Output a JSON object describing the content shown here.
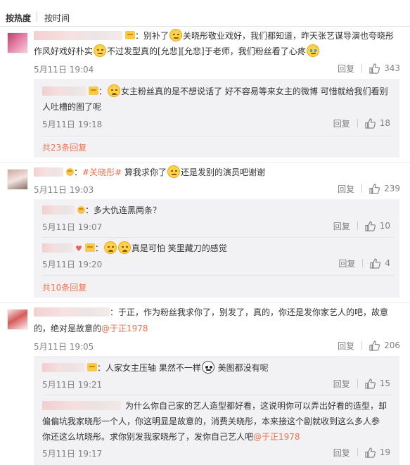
{
  "sort": {
    "hot": "按热度",
    "time": "按时间"
  },
  "icons": {
    "like": "thumbs-up-icon",
    "vip": "vip-badge-icon"
  },
  "colors": {
    "link": "#eb7350",
    "meta": "#808080",
    "subpanel": "#f2f2f5"
  },
  "comments": [
    {
      "text_parts": [
        "：别补了",
        "关晓彤敬业戏好，我们都知道，昨天张艺谋导演也夸晓彤",
        "作风好戏好朴实",
        "不过发型真的[允悲][允悲]于老师，我们粉丝看了心疼"
      ],
      "date": "5月11日 19:04",
      "reply": "回复",
      "likes": "343",
      "replies": [
        {
          "text_a": "：",
          "text_b": "女主粉丝真的是不想说话了 好不容易等来女主的微博 可惜就给我们看别",
          "text_c": "人吐槽的图了呢",
          "date": "5月11日 19:18",
          "reply": "回复",
          "likes": "18"
        }
      ],
      "more": "共23条回复"
    },
    {
      "text_a": "：",
      "topic": "#关晓彤#",
      "text_b": " 算我求你了",
      "text_c": "还是发别的演员吧谢谢",
      "date": "5月11日 19:03",
      "reply": "回复",
      "likes": "239",
      "replies": [
        {
          "text": "：多大仇连黑两条？",
          "date": "5月11日 19:07",
          "reply": "回复",
          "likes": "10"
        },
        {
          "text_a": "：",
          "text_b": "真是可怕 笑里藏刀的感觉",
          "date": "5月11日 19:20",
          "reply": "回复",
          "likes": "4"
        }
      ],
      "more": "共10条回复"
    },
    {
      "text_a": "：于正，作为粉丝我求你了，别发了，真的，你还是发你家艺人的吧，故意",
      "text_b": "的，绝对是故意的",
      "mention": "@于正1978",
      "date": "5月11日 19:05",
      "reply": "回复",
      "likes": "206",
      "replies": [
        {
          "text_a": "：人家女主压轴 果然不一样",
          "text_b": " 美图都没有呢",
          "date": "5月11日 19:21",
          "reply": "回复",
          "likes": "15"
        },
        {
          "text_a": "为什么你自己家的艺人造型都好看，这说明你可以弄出好看的造型，却",
          "text_b": "偏偏坑我家晓彤一个人，你这明显是故意的，消费关晓彤，本来接这个剧就收到这么多人参",
          "text_c": "你还这么坑晓彤。求你别发我家晓彤了，发你自己艺人吧",
          "mention": "@于正1978",
          "date": "5月11日 19:17",
          "reply": "回复",
          "likes": "19"
        }
      ]
    }
  ]
}
